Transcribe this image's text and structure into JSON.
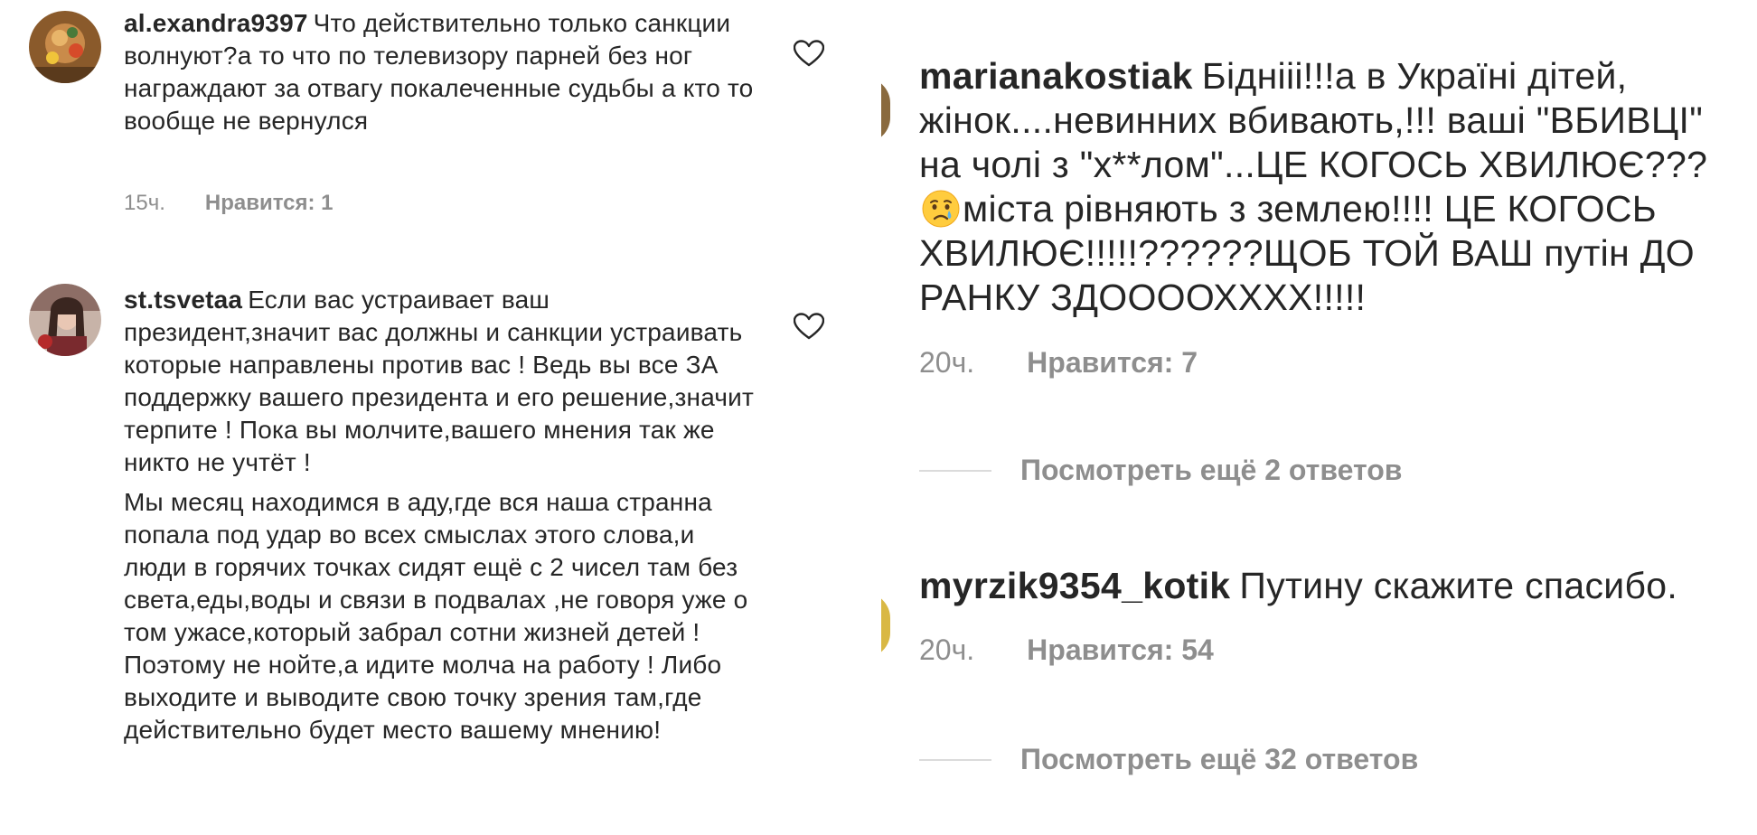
{
  "left_comments": [
    {
      "username": "al.exandra9397",
      "paragraphs": [
        "Что действительно только санкции волнуют?а то что по телевизору парней без ног награждают за отвагу покалеченные судьбы а кто то вообще не вернулся"
      ],
      "time": "15ч.",
      "likes": "Нравится: 1"
    },
    {
      "username": "st.tsvetaa",
      "paragraphs": [
        "Если вас устраивает ваш президент,значит вас должны и санкции устраивать которые направлены против вас ! Ведь вы все ЗА поддержку вашего президента и его решение,значит терпите ! Пока вы молчите,вашего мнения так же никто не учтёт !",
        "Мы месяц находимся в аду,где вся наша странна попала под удар во всех смыслах этого слова,и люди в горячих точках сидят ещё с 2 чисел там без света,еды,воды и связи в подвалах ,не говоря уже о том ужасе,который забрал сотни жизней детей ! Поэтому не нойте,а идите молча на работу ! Либо выходите и выводите свою точку зрения там,где действительно будет место вашему мнению!"
      ]
    }
  ],
  "right_comments": [
    {
      "username": "marianakostiak",
      "text_part1": "Бідніii!!!а в Україні дітей, жінок....невинних вбивають,!!! ваші \"ВБИВЦІ\" на чолі з \"х**лом\"...ЦЕ КОГОСЬ ХВИЛЮЄ???",
      "emoji": "crying-face",
      "text_part2": "міста рівняють з землею!!!! ЦЕ КОГОСЬ ХВИЛЮЄ!!!!!??????ЩОБ ТОЙ ВАШ путін ДО РАНКУ ЗДООООХХХХ!!!!!",
      "time": "20ч.",
      "likes": "Нравится: 7",
      "view_replies": "Посмотреть ещё 2 ответов"
    },
    {
      "username": "myrzik9354_kotik",
      "text": "Путину скажите спасибо.",
      "time": "20ч.",
      "likes": "Нравится: 54",
      "view_replies": "Посмотреть ещё 32 ответов"
    }
  ],
  "colors": {
    "text": "#262626",
    "secondary": "#8e8e8e",
    "divider": "#dbdbdb"
  },
  "icons": [
    "heart-outline-icon",
    "crying-face-emoji"
  ]
}
